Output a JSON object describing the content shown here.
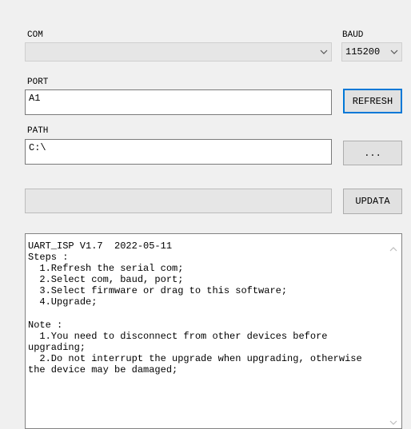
{
  "com": {
    "label": "COM",
    "value": ""
  },
  "baud": {
    "label": "BAUD",
    "value": "115200"
  },
  "port": {
    "label": "PORT",
    "value": "A1"
  },
  "refresh_button": "REFRESH",
  "path": {
    "label": "PATH",
    "value": "C:\\"
  },
  "browse_button": "...",
  "progress": {
    "fraction": 0
  },
  "update_button": "UPDATA",
  "log": {
    "lines": [
      "UART_ISP V1.7  2022-05-11",
      "Steps :",
      "  1.Refresh the serial com;",
      "  2.Select com, baud, port;",
      "  3.Select firmware or drag to this software;",
      "  4.Upgrade;",
      "",
      "Note :",
      "  1.You need to disconnect from other devices before upgrading;",
      "  2.Do not interrupt the upgrade when upgrading, otherwise the device may be damaged;"
    ]
  }
}
